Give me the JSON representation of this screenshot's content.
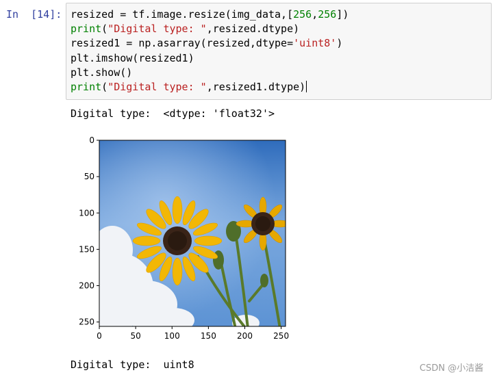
{
  "cell": {
    "prompt": "In  [14]:",
    "lines": [
      "resized = tf.image.resize(img_data,[256,256])",
      "print(\"Digital type: \",resized.dtype)",
      "resized1 = np.asarray(resized,dtype='uint8')",
      "plt.imshow(resized1)",
      "plt.show()",
      "print(\"Digital type: \",resized1.dtype)"
    ]
  },
  "output": {
    "line1": "Digital type:  <dtype: 'float32'>",
    "line2": "Digital type:  uint8"
  },
  "plot": {
    "x_ticks": [
      "0",
      "50",
      "100",
      "150",
      "200",
      "250"
    ],
    "y_ticks": [
      "0",
      "50",
      "100",
      "150",
      "200",
      "250"
    ],
    "colors": {
      "sky_top": "#3d78c4",
      "sky_mid": "#7aa8de",
      "cloud": "#f2f4f8",
      "petal": "#f2b705",
      "center": "#3a2418",
      "stem": "#5d7a2a"
    },
    "image_description_icon": "sunflower-image"
  },
  "chart_data": {
    "type": "image",
    "xlim": [
      0,
      256
    ],
    "ylim": [
      256,
      0
    ],
    "x_ticks": [
      0,
      50,
      100,
      150,
      200,
      250
    ],
    "y_ticks": [
      0,
      50,
      100,
      150,
      200,
      250
    ]
  },
  "watermark": "CSDN @小洁酱"
}
